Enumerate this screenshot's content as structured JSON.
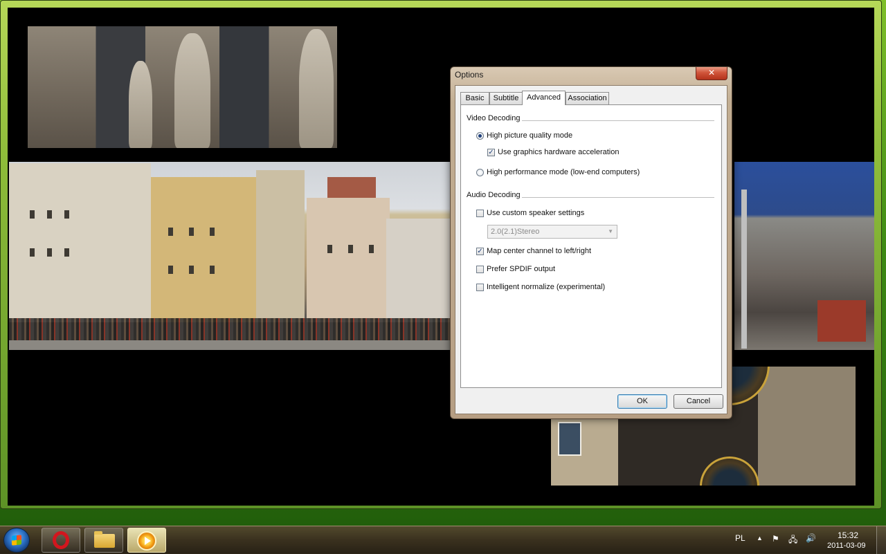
{
  "dialog": {
    "title": "Options",
    "close_label": "✕",
    "tabs": [
      {
        "label": "Basic",
        "active": false
      },
      {
        "label": "Subtitle",
        "active": false
      },
      {
        "label": "Advanced",
        "active": true
      },
      {
        "label": "Association",
        "active": false
      }
    ],
    "video_decoding": {
      "label": "Video Decoding",
      "high_quality": {
        "label": "High picture quality mode",
        "checked": true
      },
      "hw_accel": {
        "label": "Use graphics hardware acceleration",
        "checked": true
      },
      "high_performance": {
        "label": "High performance mode (low-end computers)",
        "checked": false
      }
    },
    "audio_decoding": {
      "label": "Audio Decoding",
      "custom_speaker": {
        "label": "Use custom speaker settings",
        "checked": false
      },
      "speaker_select_value": "2.0(2.1)Stereo",
      "map_center": {
        "label": "Map center channel to left/right",
        "checked": true
      },
      "prefer_spdif": {
        "label": "Prefer SPDIF output",
        "checked": false
      },
      "intelligent_normalize": {
        "label": "Intelligent normalize (experimental)",
        "checked": false
      }
    },
    "ok_label": "OK",
    "cancel_label": "Cancel"
  },
  "taskbar": {
    "apps": [
      "opera-icon",
      "windows-explorer-icon",
      "media-player-icon"
    ],
    "language": "PL",
    "time": "15:32",
    "date": "2011-03-09",
    "accent": "#3e8a14"
  }
}
